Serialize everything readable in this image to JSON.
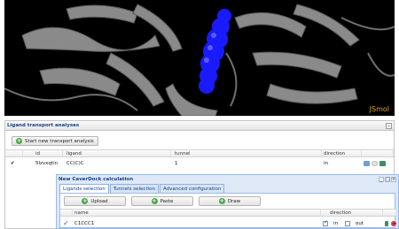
{
  "viewer": {
    "label": "JSmol"
  },
  "panel": {
    "title": "Ligand transport analyses",
    "start_button": "Start new transport analysis",
    "columns": {
      "id": "id",
      "ligand": "ligand",
      "tunnel": "tunnel",
      "direction": "direction"
    },
    "rows": [
      {
        "status": "✔",
        "id": "5lzvxqtin",
        "ligand": "CC(C)C",
        "tunnel": "1",
        "direction": "in"
      }
    ]
  },
  "window": {
    "title": "New CaverDock calculation",
    "tabs": [
      "Ligands selection",
      "Tunnels selection",
      "Advanced configuration"
    ],
    "buttons": {
      "upload": "Upload",
      "paste": "Paste",
      "draw": "Draw"
    },
    "columns": {
      "name": "name",
      "direction": "direction"
    },
    "rows": [
      {
        "name": "C1CCC1",
        "in_label": "in",
        "out_label": "out"
      }
    ]
  },
  "colors": {
    "accent": "#15428b",
    "ok": "#2e9a2e",
    "jsmol": "#e8a317",
    "tunnel": "#1a1aff"
  }
}
